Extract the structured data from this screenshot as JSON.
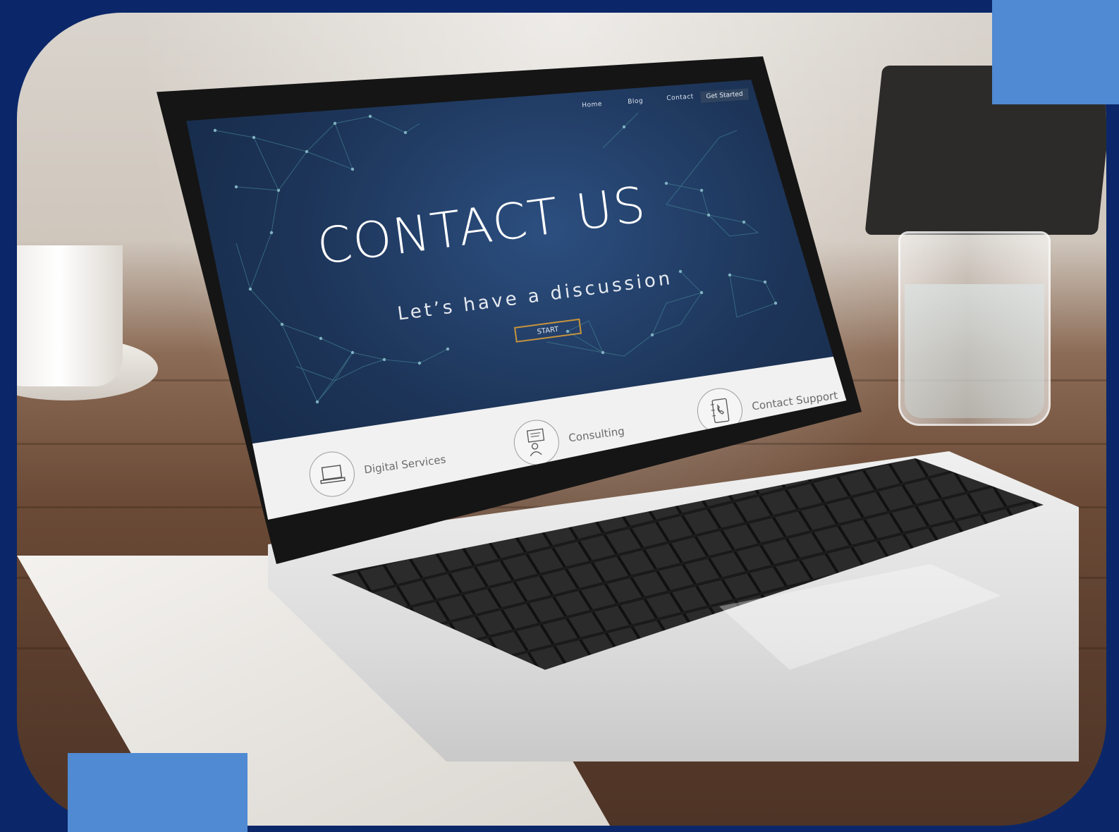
{
  "screen": {
    "nav": [
      "Home",
      "Blog",
      "Contact"
    ],
    "nav_cta": "Get Started",
    "heading": "CONTACT US",
    "subheading": "Let’s have a discussion",
    "start_button": "START",
    "services": [
      {
        "label": "Digital Services",
        "icon": "laptop-icon"
      },
      {
        "label": "Consulting",
        "icon": "presentation-icon"
      },
      {
        "label": "Contact Support",
        "icon": "phone-book-icon"
      }
    ]
  },
  "colors": {
    "page_border": "#0b2769",
    "accent_blocks": "#4f8ad3",
    "screen_bg": "#1d3559",
    "button_border": "#c9943c"
  }
}
